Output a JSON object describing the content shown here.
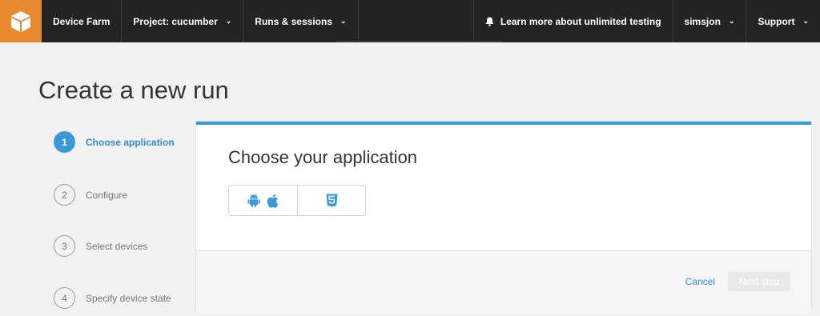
{
  "nav": {
    "product": "Device Farm",
    "project": "Project: cucumber",
    "runs": "Runs & sessions",
    "learn_more": "Learn more about unlimited testing",
    "user": "simsjon",
    "support": "Support"
  },
  "page": {
    "title": "Create a new run"
  },
  "steps": [
    {
      "num": "1",
      "label": "Choose application",
      "active": true
    },
    {
      "num": "2",
      "label": "Configure",
      "active": false
    },
    {
      "num": "3",
      "label": "Select devices",
      "active": false
    },
    {
      "num": "4",
      "label": "Specify device state",
      "active": false
    }
  ],
  "card": {
    "heading": "Choose your application",
    "app_types": [
      {
        "icons": [
          "android-icon",
          "apple-icon"
        ]
      },
      {
        "icons": [
          "html5-icon"
        ]
      }
    ],
    "cancel_label": "Cancel",
    "next_label": "Next step"
  },
  "colors": {
    "accent": "#3a9ad9",
    "brand_orange": "#e8892d",
    "nav_bg": "#232323"
  }
}
